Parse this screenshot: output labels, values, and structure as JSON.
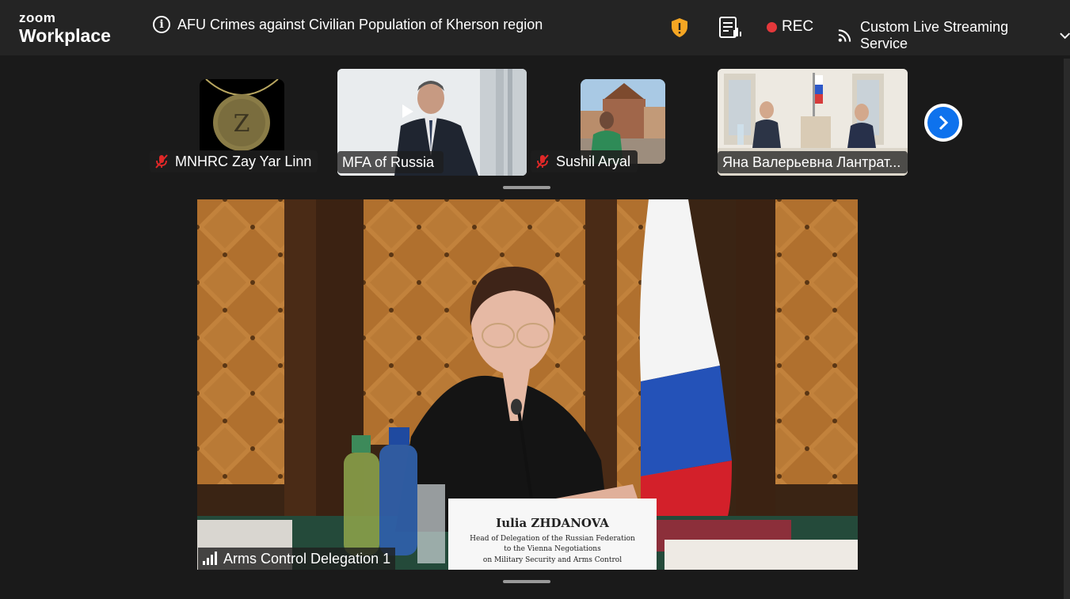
{
  "app": {
    "logo_line1": "zoom",
    "logo_line2": "Workplace"
  },
  "meeting": {
    "title": "AFU Crimes against Civilian Population of Kherson region"
  },
  "toolbar": {
    "shield_icon": "security-shield-icon",
    "captions_icon": "transcript-icon",
    "rec_label": "REC",
    "stream_label": "Custom Live Streaming Service",
    "colors": {
      "rec_dot": "#e5383b",
      "shield": "#f5a623"
    }
  },
  "participants": [
    {
      "name": "MNHRC Zay Yar Linn",
      "muted": true
    },
    {
      "name": "MFA of Russia",
      "muted": false
    },
    {
      "name": "Sushil Aryal",
      "muted": true
    },
    {
      "name": "Яна Валерьевна Лантрат...",
      "muted": false
    }
  ],
  "main_speaker": {
    "name": "Arms Control Delegation 1",
    "nameplate_name": "Iulia ZHDANOVA",
    "nameplate_line1": "Head of Delegation of the Russian Federation",
    "nameplate_line2": "to the Vienna Negotiations",
    "nameplate_line3": "on Military Security and Arms Control"
  },
  "accent_color": "#0e72ed"
}
